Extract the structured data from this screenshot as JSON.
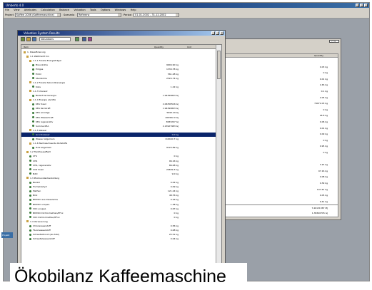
{
  "app": {
    "title": "Umberto 4.0"
  },
  "menu": [
    "File",
    "View",
    "Attributes",
    "Calculation",
    "Balance",
    "Valuation",
    "Tools",
    "Options",
    "Windows",
    "Help"
  ],
  "toolbar": {
    "project_label": "Project",
    "project_value": "Kaffee 2006 (Kaffeemaschine) ",
    "scenario_label": "Scenario",
    "scenario_value": "Referenz",
    "period_label": "Period",
    "period_value": "01.01.2002 - 31.12.2002"
  },
  "main_window": {
    "title": "Valuation System Results",
    "selector_value": "Valuations",
    "columns": [
      "Item",
      "Quantity",
      "Unit"
    ],
    "rows": [
      {
        "label": "1. Klassifizierung",
        "q": "",
        "u": "",
        "lvl": 0,
        "type": "folder"
      },
      {
        "label": "1.1 Weltmarkt Inn",
        "q": "",
        "u": "",
        "lvl": 1,
        "type": "folder"
      },
      {
        "label": "1.1.1 Fossile Energieträger",
        "q": "",
        "u": "",
        "lvl": 2,
        "type": "folder"
      },
      {
        "label": "Braunkohle",
        "q": "9646.90 kg",
        "u": "",
        "lvl": 3,
        "type": "item"
      },
      {
        "label": "Erdgas",
        "q": "1330.78 kg",
        "u": "",
        "lvl": 3,
        "type": "item"
      },
      {
        "label": "Erdöl",
        "q": "561.28 kg",
        "u": "",
        "lvl": 3,
        "type": "item"
      },
      {
        "label": "Steinkohle",
        "q": "2324.74 kg",
        "u": "",
        "lvl": 3,
        "type": "item"
      },
      {
        "label": "1.1.2 Fossile Sekundärenergie",
        "q": "",
        "u": "",
        "lvl": 2,
        "type": "folder"
      },
      {
        "label": "Koks",
        "q": "1.22 kg",
        "u": "",
        "lvl": 3,
        "type": "item"
      },
      {
        "label": "1.1.3 Uranerz",
        "q": "",
        "u": "",
        "lvl": 2,
        "type": "folder"
      },
      {
        "label": "Bedarf Kernenergie",
        "q": "1.94399803 GJ",
        "u": "",
        "lvl": 3,
        "type": "item"
      },
      {
        "label": "1.1.4 Energie als KEA",
        "q": "",
        "u": "",
        "lvl": 2,
        "type": "folder"
      },
      {
        "label": "KEA fossil",
        "q": "2.06358526 GJ",
        "u": "",
        "lvl": 3,
        "type": "item"
      },
      {
        "label": "KEA Kernkraft",
        "q": "1.94399803 GJ",
        "u": "",
        "lvl": 3,
        "type": "item"
      },
      {
        "label": "KEA sonstige",
        "q": "5693.29 GJ",
        "u": "",
        "lvl": 3,
        "type": "item"
      },
      {
        "label": "KEA Wasserkraft",
        "q": "409992.0 GJ",
        "u": "",
        "lvl": 3,
        "type": "item"
      },
      {
        "label": "KEA regenerativ",
        "q": "3083297 GJ",
        "u": "",
        "lvl": 3,
        "type": "item"
      },
      {
        "label": "Summe KEA",
        "q": "2.13927983 GJ",
        "u": "",
        "lvl": 3,
        "type": "item"
      },
      {
        "label": "1.1.5 Wasser",
        "q": "",
        "u": "",
        "lvl": 2,
        "type": "folder"
      },
      {
        "label": "Grundwasser",
        "q": "0.0 kg",
        "u": "",
        "lvl": 3,
        "type": "item",
        "sel": true
      },
      {
        "label": "Wasser allgemein",
        "q": "116440.7 kg",
        "u": "",
        "lvl": 3,
        "type": "item"
      },
      {
        "label": "1.1.6 Nachwachsende Rohstoffe",
        "q": "",
        "u": "",
        "lvl": 2,
        "type": "folder"
      },
      {
        "label": "Holz allgemein",
        "q": "9124.89 kg",
        "u": "",
        "lvl": 3,
        "type": "item"
      },
      {
        "label": "1.2 Treibhauseffekt",
        "q": "",
        "u": "",
        "lvl": 1,
        "type": "folder"
      },
      {
        "label": "CF4",
        "q": "0 kg",
        "u": "",
        "lvl": 2,
        "type": "item"
      },
      {
        "label": "CH4",
        "q": "96.16 kg",
        "u": "",
        "lvl": 2,
        "type": "item"
      },
      {
        "label": "CH4, regenerativ",
        "q": "86.08 kg",
        "u": "",
        "lvl": 2,
        "type": "item"
      },
      {
        "label": "CO2 fossil",
        "q": "20609.3 kg",
        "u": "",
        "lvl": 2,
        "type": "item"
      },
      {
        "label": "N2O",
        "q": "9.0 kg",
        "u": "",
        "lvl": 2,
        "type": "item"
      },
      {
        "label": "1.3 Photooxidantienbildung",
        "q": "",
        "u": "",
        "lvl": 1,
        "type": "folder"
      },
      {
        "label": "Benzol",
        "q": "0.02 kg",
        "u": "",
        "lvl": 2,
        "type": "item"
      },
      {
        "label": "Formaldehyd",
        "q": "0.09 kg",
        "u": "",
        "lvl": 2,
        "type": "item"
      },
      {
        "label": "Methan",
        "q": "121.24 kg",
        "u": "",
        "lvl": 2,
        "type": "item"
      },
      {
        "label": "NOx",
        "q": "48.76 kg",
        "u": "",
        "lvl": 2,
        "type": "item"
      },
      {
        "label": "NMVOC aus Dieselemis",
        "q": "0.16 kg",
        "u": "",
        "lvl": 2,
        "type": "item"
      },
      {
        "label": "NMVOC unspez.",
        "q": "1.38 kg",
        "u": "",
        "lvl": 2,
        "type": "item"
      },
      {
        "label": "VOC unspez.",
        "q": "0.67 kg",
        "u": "",
        "lvl": 2,
        "type": "item"
      },
      {
        "label": "NMVOC Dichlormethan/PFxx",
        "q": "0 kg",
        "u": "",
        "lvl": 2,
        "type": "item"
      },
      {
        "label": "VOC Dichlormethan/PFxx",
        "q": "0 kg",
        "u": "",
        "lvl": 2,
        "type": "item"
      },
      {
        "label": "1.4 Versauerung",
        "q": "",
        "u": "",
        "lvl": 1,
        "type": "folder"
      },
      {
        "label": "Chlorwasserstoff",
        "q": "0.56 kg",
        "u": "",
        "lvl": 2,
        "type": "item"
      },
      {
        "label": "Fluorwasserstoff",
        "q": "0.08 kg",
        "u": "",
        "lvl": 2,
        "type": "item"
      },
      {
        "label": "Schwefeldioxid (als SO2)",
        "q": "25.51 kg",
        "u": "",
        "lvl": 2,
        "type": "item"
      },
      {
        "label": "Schwefelwasserstoff",
        "q": "0.04 kg",
        "u": "",
        "lvl": 2,
        "type": "item"
      }
    ]
  },
  "back_window": {
    "column": "Quantity",
    "rows": [
      {
        "label": "",
        "q": ""
      },
      {
        "label": "nent (AdB)",
        "q": "0.03 kg"
      },
      {
        "label": "nent (AdB)",
        "q": "0 kg"
      },
      {
        "label": "",
        "q": "0.01 kg"
      },
      {
        "label": "",
        "q": "2.46 kg"
      },
      {
        "label": "",
        "q": "0.1 kg"
      },
      {
        "label": "",
        "q": "2.05 kg"
      },
      {
        "label": "",
        "q": "74972.03 kg"
      },
      {
        "label": "",
        "q": "0 kg"
      },
      {
        "label": "",
        "q": "24.8 kg"
      },
      {
        "label": "",
        "q": "0.06 kg"
      },
      {
        "label": "",
        "q": "0.01 kg"
      },
      {
        "label": "",
        "q": "0.09 kg"
      },
      {
        "label": "",
        "q": "0 kg"
      },
      {
        "label": "",
        "q": "0.95 kg"
      },
      {
        "label": "",
        "q": "0 kg"
      },
      {
        "label": "",
        "q": ""
      },
      {
        "label": "",
        "q": "3.15 kg"
      },
      {
        "label": "",
        "q": "97.16 kg"
      },
      {
        "label": "",
        "q": "0.08 kg"
      },
      {
        "label": "",
        "q": "0.39 kg"
      },
      {
        "label": "",
        "q": "107.67 kg"
      },
      {
        "label": "",
        "q": "0.05 kg"
      },
      {
        "label": "",
        "q": "9.41 kg"
      }
    ],
    "lower_rows": [
      "7.46131387 MJ",
      "1.38346705 GJ"
    ]
  },
  "taskbar_item": "Projekt",
  "caption": "Ökobilanz Kaffeemaschine"
}
